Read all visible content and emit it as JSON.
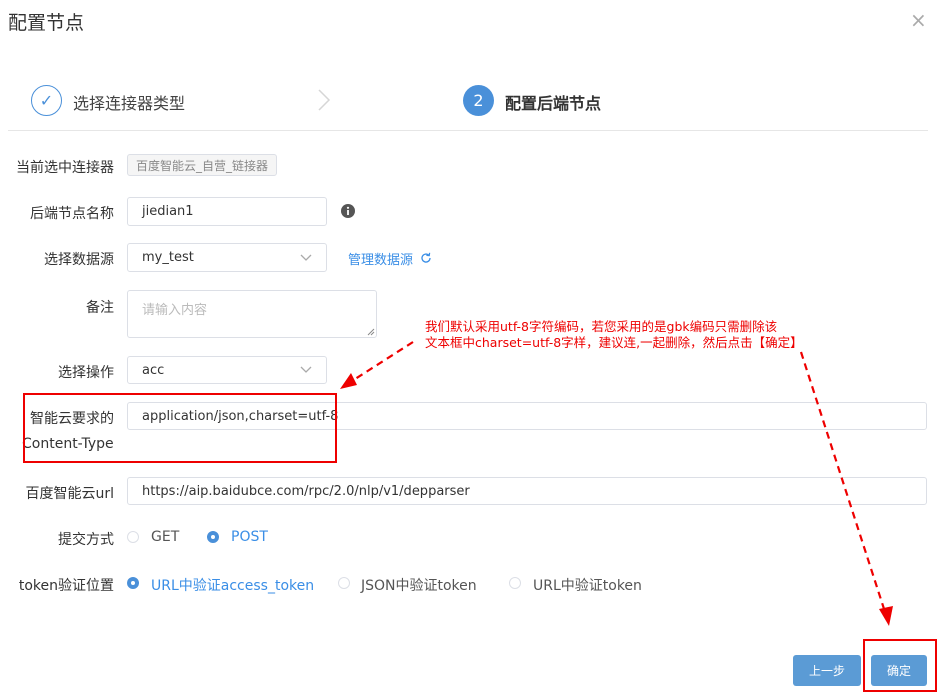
{
  "dialog": {
    "title": "配置节点",
    "close_glyph": "×"
  },
  "steps": [
    {
      "label": "选择连接器类型",
      "status": "done",
      "glyph": "✓"
    },
    {
      "label": "配置后端节点",
      "status": "active",
      "number": "2"
    }
  ],
  "form": {
    "connector": {
      "label": "当前选中连接器",
      "value": "百度智能云_自营_链接器"
    },
    "backend_name": {
      "label": "后端节点名称",
      "value": "jiedian1"
    },
    "datasource": {
      "label": "选择数据源",
      "value": "my_test",
      "manage_link": "管理数据源"
    },
    "remark": {
      "label": "备注",
      "placeholder": "请输入内容"
    },
    "operation": {
      "label": "选择操作",
      "value": "acc"
    },
    "content_type": {
      "label_line1": "智能云要求的",
      "label_line2": "Content-Type",
      "value": "application/json,charset=utf-8"
    },
    "url": {
      "label": "百度智能云url",
      "value": "https://aip.baidubce.com/rpc/2.0/nlp/v1/depparser"
    },
    "method": {
      "label": "提交方式",
      "options": [
        "GET",
        "POST"
      ],
      "selected": "POST"
    },
    "token_position": {
      "label": "token验证位置",
      "options": [
        "URL中验证access_token",
        "JSON中验证token",
        "URL中验证token"
      ],
      "selected": "URL中验证access_token"
    }
  },
  "annotation": {
    "line1": "我们默认采用utf-8字符编码，若您采用的是gbk编码只需删除该",
    "line2": "文本框中charset=utf-8字样，建议连,一起删除，然后点击【确定】",
    "color": "#e60012"
  },
  "buttons": {
    "prev": "上一步",
    "confirm": "确定"
  },
  "colors": {
    "accent": "#4a90d9",
    "button": "#5b9bd5"
  }
}
